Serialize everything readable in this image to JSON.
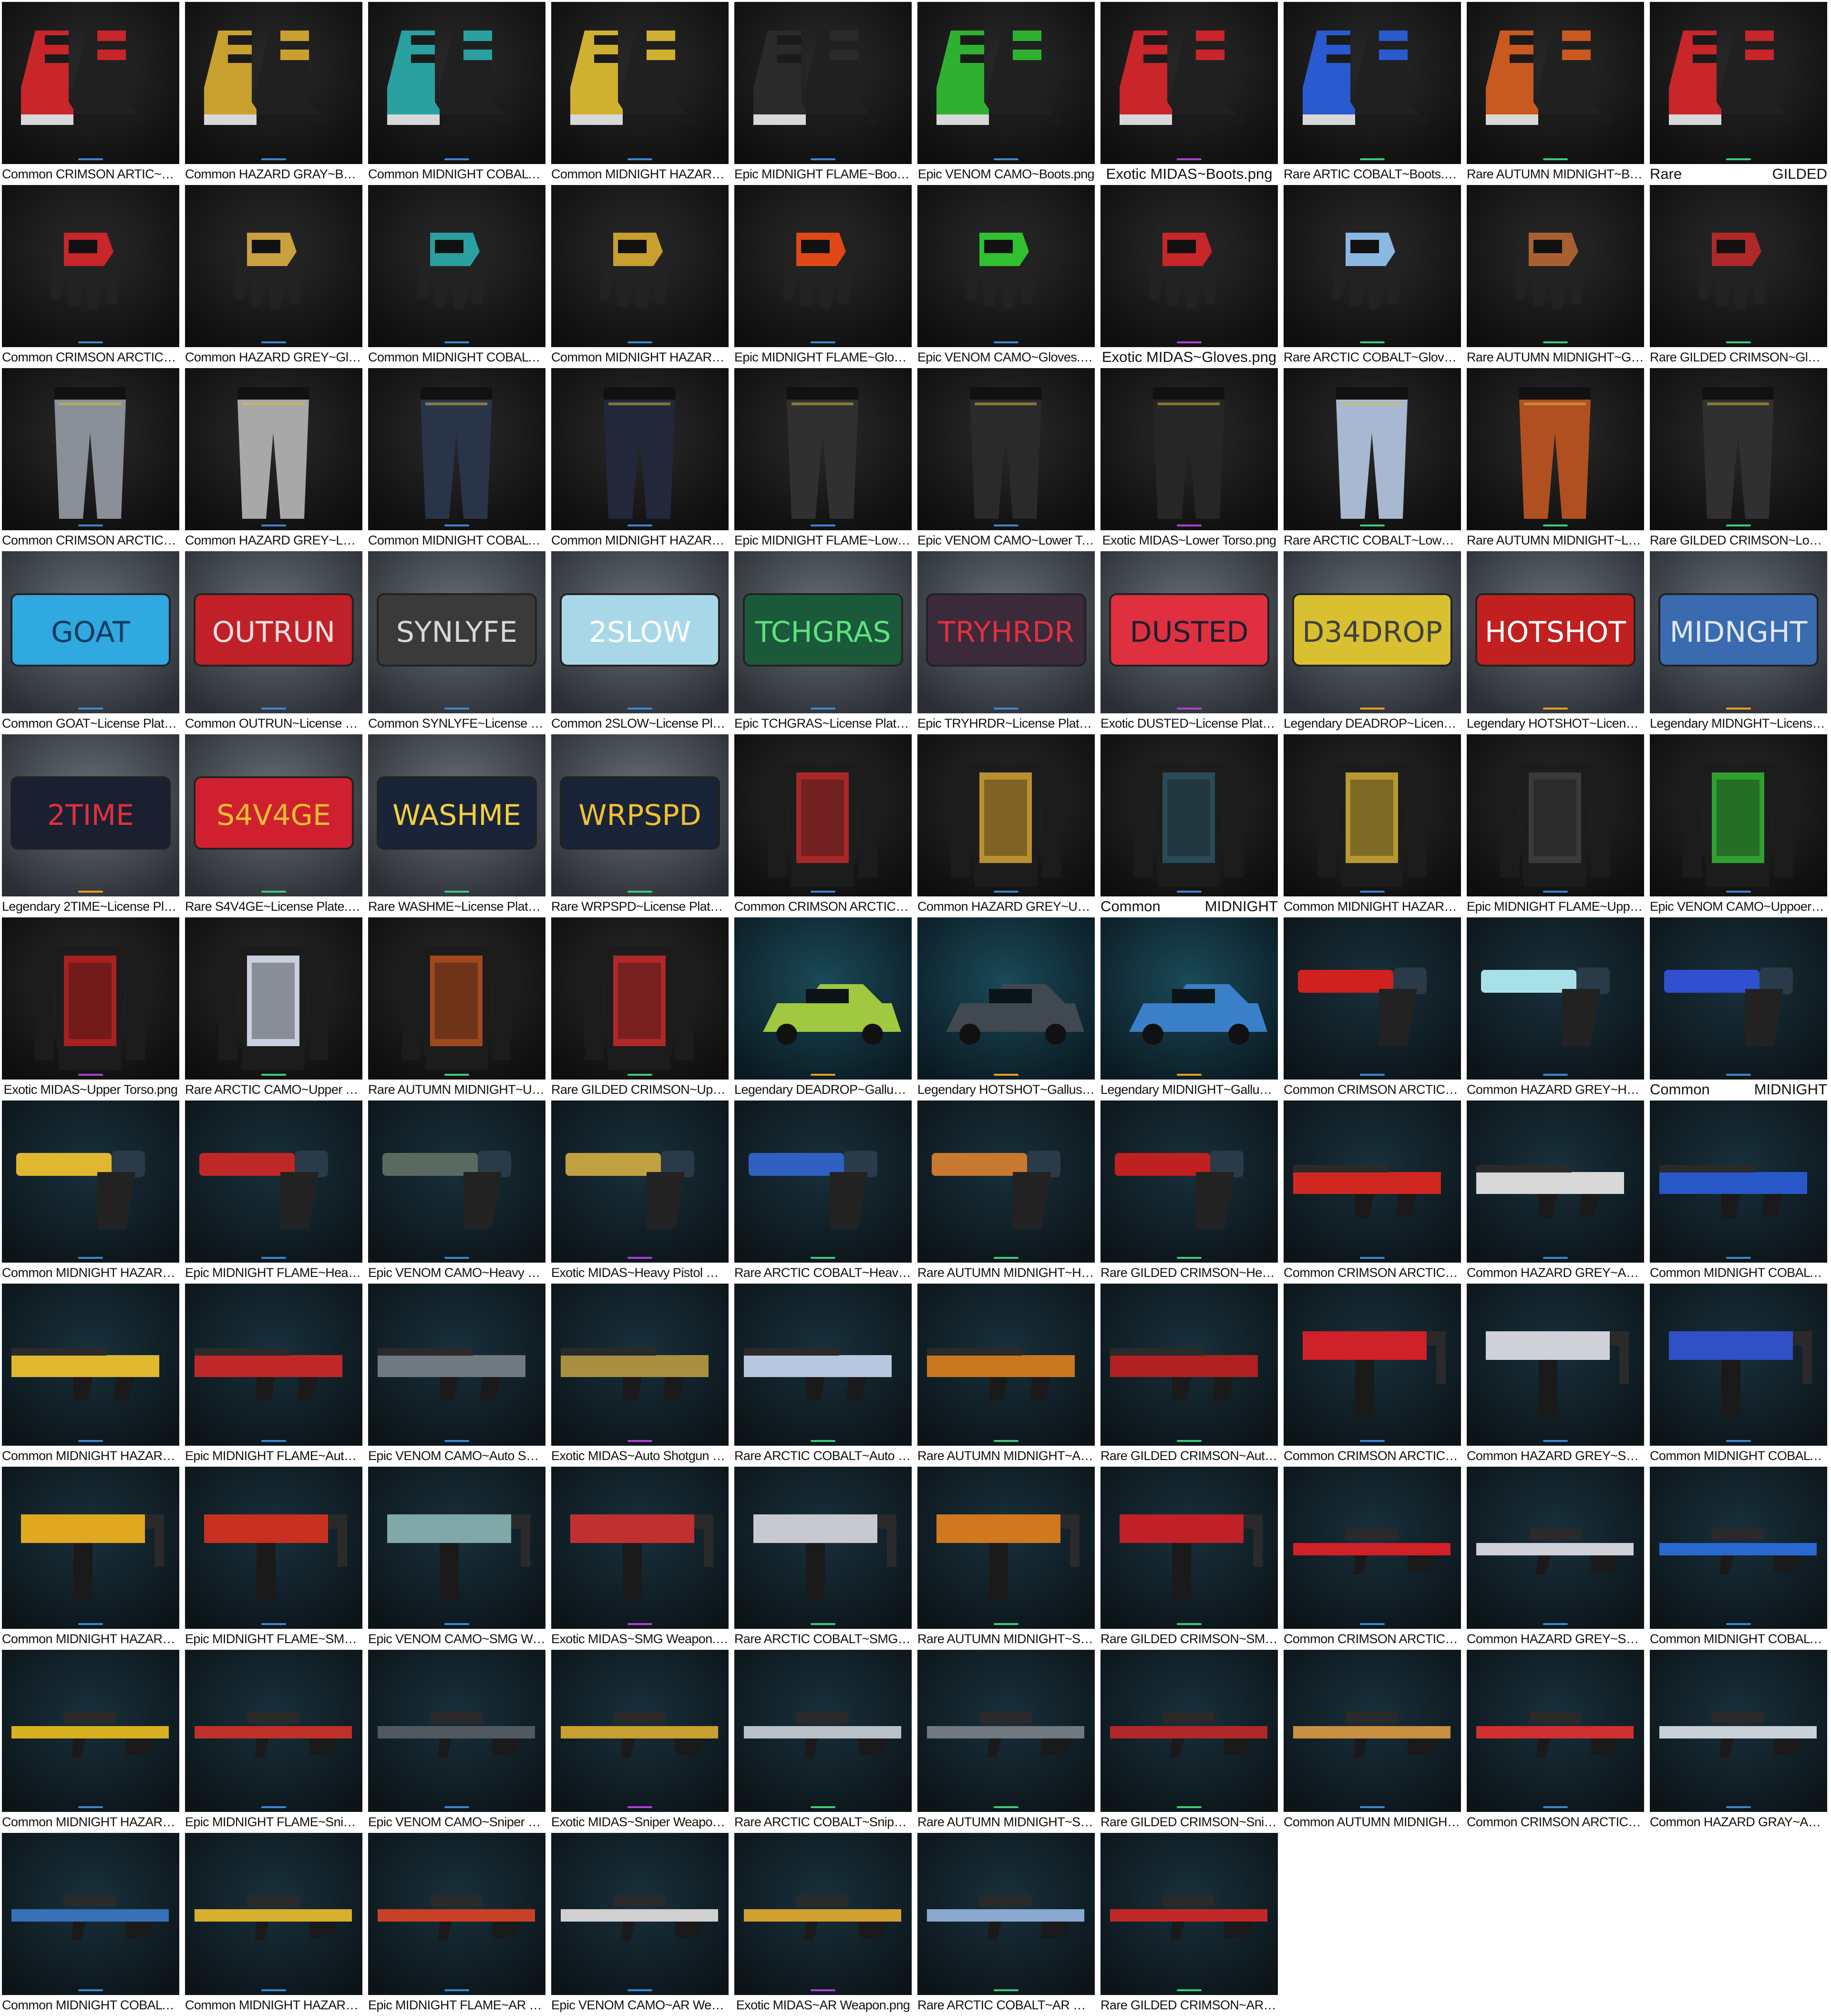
{
  "window": {
    "title": ""
  },
  "accent_colors": {
    "common": "#3a8ad8",
    "epic": "#3a8ad8",
    "exotic": "#b040d8",
    "rare": "#3ad07a",
    "legendary": "#f0a020"
  },
  "tiles": [
    {
      "label": "Common CRIMSON ARTIC~Boots.png",
      "category": "boots",
      "color": "#c8262a",
      "accent": "common"
    },
    {
      "label": "Common HAZARD GRAY~Boots.png",
      "category": "boots",
      "color": "#c8a030",
      "accent": "common"
    },
    {
      "label": "Common MIDNIGHT COBALT~Boots.png",
      "category": "boots",
      "color": "#2aa0a0",
      "accent": "common"
    },
    {
      "label": "Common MIDNIGHT HAZARD~Boots.png",
      "category": "boots",
      "color": "#d0b030",
      "accent": "common"
    },
    {
      "label": "Epic MIDNIGHT FLAME~Boots.png",
      "category": "boots",
      "color": "#2a2a2a",
      "accent": "epic"
    },
    {
      "label": "Epic VENOM CAMO~Boots.png",
      "category": "boots",
      "color": "#30b030",
      "accent": "epic"
    },
    {
      "label": "Exotic MIDAS~Boots.png",
      "category": "boots",
      "color": "#c8262a",
      "accent": "exotic"
    },
    {
      "label": "Rare ARTIC COBALT~Boots.png",
      "category": "boots",
      "color": "#2a5ad0",
      "accent": "rare"
    },
    {
      "label": "Rare AUTUMN MIDNIGHT~Boots.png",
      "category": "boots",
      "color": "#c85a20",
      "accent": "rare"
    },
    {
      "label": "Rare GILDED CRIMSON~Boots.png",
      "category": "boots",
      "color": "#c8262a",
      "accent": "rare",
      "split": [
        "Rare",
        "GILDED"
      ]
    },
    {
      "label": "Common CRIMSON ARCTIC~Gloves.png",
      "category": "gloves",
      "color": "#c8262a",
      "accent": "common"
    },
    {
      "label": "Common HAZARD GREY~Gloves.png",
      "category": "gloves",
      "color": "#c8a040",
      "accent": "common"
    },
    {
      "label": "Common MIDNIGHT COBALT~Gloves.png",
      "category": "gloves",
      "color": "#2aa0a0",
      "accent": "common"
    },
    {
      "label": "Common MIDNIGHT HAZARD~Gloves.png",
      "category": "gloves",
      "color": "#c8a030",
      "accent": "common"
    },
    {
      "label": "Epic MIDNIGHT FLAME~Gloves.png",
      "category": "gloves",
      "color": "#e04818",
      "accent": "epic"
    },
    {
      "label": "Epic VENOM CAMO~Gloves.png",
      "category": "gloves",
      "color": "#30c030",
      "accent": "epic"
    },
    {
      "label": "Exotic MIDAS~Gloves.png",
      "category": "gloves",
      "color": "#c8262a",
      "accent": "exotic"
    },
    {
      "label": "Rare ARCTIC COBALT~Gloves.png",
      "category": "gloves",
      "color": "#8ab8e0",
      "accent": "rare"
    },
    {
      "label": "Rare AUTUMN MIDNIGHT~Gloves.png",
      "category": "gloves",
      "color": "#a86030",
      "accent": "rare"
    },
    {
      "label": "Rare GILDED CRIMSON~Gloves.png",
      "category": "gloves",
      "color": "#b02828",
      "accent": "rare"
    },
    {
      "label": "Common CRIMSON ARCTIC~Lower Torso.png",
      "category": "pants",
      "color": "#8a9098",
      "accent": "common"
    },
    {
      "label": "Common HAZARD GREY~Lower Torso.png",
      "category": "pants",
      "color": "#a8a8a8",
      "accent": "common"
    },
    {
      "label": "Common MIDNIGHT COBALT~Lower Torso.png",
      "category": "pants",
      "color": "#2a3448",
      "accent": "common"
    },
    {
      "label": "Common MIDNIGHT HAZARD~Lower Torso.png",
      "category": "pants",
      "color": "#22283a",
      "accent": "common"
    },
    {
      "label": "Epic MIDNIGHT FLAME~Lower Torso.png",
      "category": "pants",
      "color": "#303030",
      "accent": "epic"
    },
    {
      "label": "Epic VENOM CAMO~Lower Torso.png",
      "category": "pants",
      "color": "#2a2a2a",
      "accent": "epic"
    },
    {
      "label": "Exotic MIDAS~Lower Torso.png",
      "category": "pants",
      "color": "#262626",
      "accent": "exotic"
    },
    {
      "label": "Rare ARCTIC COBALT~Lower Torso.png",
      "category": "pants",
      "color": "#a8b8d0",
      "accent": "rare"
    },
    {
      "label": "Rare AUTUMN MIDNIGHT~Lower Torso.png",
      "category": "pants",
      "color": "#b05020",
      "accent": "rare"
    },
    {
      "label": "Rare GILDED CRIMSON~Lower Torso.png",
      "category": "pants",
      "color": "#303030",
      "accent": "rare"
    },
    {
      "label": "Common GOAT~License Plate.png",
      "category": "plate",
      "color": "#30a8e0",
      "accent": "common",
      "plate_text": "GOAT",
      "text_color": "#0a3a60"
    },
    {
      "label": "Common OUTRUN~License Plate.png",
      "category": "plate",
      "color": "#c02028",
      "accent": "common",
      "plate_text": "OUTRUN",
      "text_color": "#f0e0e0"
    },
    {
      "label": "Common SYNLYFE~License Plate.png",
      "category": "plate",
      "color": "#3a3a3a",
      "accent": "common",
      "plate_text": "SYNLYFE",
      "text_color": "#d8d8d8"
    },
    {
      "label": "Common 2SLOW~License Plate.png",
      "category": "plate",
      "color": "#a8d8e8",
      "accent": "common",
      "plate_text": "2SLOW",
      "text_color": "#ffffff"
    },
    {
      "label": "Epic TCHGRAS~License Plate.png",
      "category": "plate",
      "color": "#1a5a3a",
      "accent": "epic",
      "plate_text": "TCHGRAS",
      "text_color": "#60e080"
    },
    {
      "label": "Epic TRYHRDR~License Plate.png",
      "category": "plate",
      "color": "#3a2a3a",
      "accent": "epic",
      "plate_text": "TRYHRDR",
      "text_color": "#e03040"
    },
    {
      "label": "Exotic DUSTED~License Plate.png",
      "category": "plate",
      "color": "#e03040",
      "accent": "exotic",
      "plate_text": "DUSTED",
      "text_color": "#1a2030"
    },
    {
      "label": "Legendary DEADROP~License Plate.png",
      "category": "plate",
      "color": "#d8c030",
      "accent": "legendary",
      "plate_text": "D34DROP",
      "text_color": "#404040"
    },
    {
      "label": "Legendary HOTSHOT~License Plate.png",
      "category": "plate",
      "color": "#c02020",
      "accent": "legendary",
      "plate_text": "HOTSHOT",
      "text_color": "#ffffff"
    },
    {
      "label": "Legendary MIDNGHT~License Plate.png",
      "category": "plate",
      "color": "#3a6ab0",
      "accent": "legendary",
      "plate_text": "MIDNGHT",
      "text_color": "#e0e8f0"
    },
    {
      "label": "Legendary 2TIME~License Plate.png",
      "category": "plate",
      "color": "#1a2030",
      "accent": "legendary",
      "plate_text": "2TIME",
      "text_color": "#e03040"
    },
    {
      "label": "Rare S4V4GE~License Plate.png",
      "category": "plate",
      "color": "#d02030",
      "accent": "rare",
      "plate_text": "S4V4GE",
      "text_color": "#f0c030"
    },
    {
      "label": "Rare WASHME~License Plate.png",
      "category": "plate",
      "color": "#1a2438",
      "accent": "rare",
      "plate_text": "WASHME",
      "text_color": "#f0d040"
    },
    {
      "label": "Rare WRPSPD~License Plate.png",
      "category": "plate",
      "color": "#1a2438",
      "accent": "rare",
      "plate_text": "WRPSPD",
      "text_color": "#f0c030"
    },
    {
      "label": "Common CRIMSON ARCTIC~Upper Torso.png",
      "category": "jacket",
      "color": "#a82828",
      "accent": "common"
    },
    {
      "label": "Common HAZARD GREY~Upper Torso.png",
      "category": "jacket",
      "color": "#b89030",
      "accent": "common"
    },
    {
      "label": "Common MIDNIGHT COBALT~Upper Torso.png",
      "category": "jacket",
      "color": "#2a4a58",
      "accent": "common",
      "split": [
        "Common",
        "MIDNIGHT"
      ]
    },
    {
      "label": "Common MIDNIGHT HAZARD~Upper Torso.png",
      "category": "jacket",
      "color": "#b89830",
      "accent": "common"
    },
    {
      "label": "Epic MIDNIGHT FLAME~Upper Torso.png",
      "category": "jacket",
      "color": "#3a3a3a",
      "accent": "epic"
    },
    {
      "label": "Epic VENOM CAMO~Uppoer Torso.png",
      "category": "jacket",
      "color": "#30a030",
      "accent": "epic"
    },
    {
      "label": "Exotic MIDAS~Upper Torso.png",
      "category": "jacket",
      "color": "#a82020",
      "accent": "exotic"
    },
    {
      "label": "Rare ARCTIC CAMO~Upper Torso.png",
      "category": "jacket",
      "color": "#c8d0e0",
      "accent": "rare"
    },
    {
      "label": "Rare AUTUMN MIDNIGHT~Upper Torso.png",
      "category": "jacket",
      "color": "#a04820",
      "accent": "rare"
    },
    {
      "label": "Rare GILDED CRIMSON~Upper Torso.png",
      "category": "jacket",
      "color": "#b02828",
      "accent": "rare"
    },
    {
      "label": "Legendary DEADROP~Gallus Vehicle.png",
      "category": "car",
      "color": "#a0c840",
      "accent": "legendary"
    },
    {
      "label": "Legendary HOTSHOT~Gallus Vehicle.png",
      "category": "car",
      "color": "#404850",
      "accent": "legendary"
    },
    {
      "label": "Legendary MIDNIGHT~Gallus Vehicle.png",
      "category": "car",
      "color": "#3a80c8",
      "accent": "legendary"
    },
    {
      "label": "Common CRIMSON ARCTIC~Heavy Pistol Weapon.png",
      "category": "pistol",
      "color": "#d02020",
      "accent": "common"
    },
    {
      "label": "Common HAZARD GREY~Heavy Pistol Weapon.png",
      "category": "pistol",
      "color": "#a8e0e8",
      "accent": "common"
    },
    {
      "label": "Common MIDNIGHT COBALT~Heavy Pistol Weapon.png",
      "category": "pistol",
      "color": "#3050d0",
      "accent": "common",
      "split": [
        "Common",
        "MIDNIGHT"
      ]
    },
    {
      "label": "Common MIDNIGHT HAZARD~Heavy Pistol Weapon.png",
      "category": "pistol",
      "color": "#e0b830",
      "accent": "common"
    },
    {
      "label": "Epic MIDNIGHT FLAME~Heavy Pistol Weapon.png",
      "category": "pistol",
      "color": "#c02828",
      "accent": "epic"
    },
    {
      "label": "Epic VENOM CAMO~Heavy Pistol Weapon.png",
      "category": "pistol",
      "color": "#5a6a60",
      "accent": "epic"
    },
    {
      "label": "Exotic MIDAS~Heavy Pistol Weapon.png",
      "category": "pistol",
      "color": "#c0a040",
      "accent": "exotic"
    },
    {
      "label": "Rare ARCTIC COBALT~Heavy Pistol Weapon.png",
      "category": "pistol",
      "color": "#3060c0",
      "accent": "rare"
    },
    {
      "label": "Rare AUTUMN MIDNIGHT~Heavy Pistol Weapon.png",
      "category": "pistol",
      "color": "#c87830",
      "accent": "rare"
    },
    {
      "label": "Rare GILDED CRIMSON~Heavy Pistol Weapon.png",
      "category": "pistol",
      "color": "#c02020",
      "accent": "rare"
    },
    {
      "label": "Common CRIMSON ARCTIC~Auto Shotgun Weapon.png",
      "category": "shotgun",
      "color": "#d02820",
      "accent": "common"
    },
    {
      "label": "Common HAZARD GREY~Auto Shotgun Weapon.png",
      "category": "shotgun",
      "color": "#d8d8d8",
      "accent": "common"
    },
    {
      "label": "Common MIDNIGHT COBALT~Auto Shotgun Weapon.png",
      "category": "shotgun",
      "color": "#2858c8",
      "accent": "common"
    },
    {
      "label": "Common MIDNIGHT HAZARD~Auto Shotgun Weapon.png",
      "category": "shotgun",
      "color": "#e0b830",
      "accent": "common"
    },
    {
      "label": "Epic MIDNIGHT FLAME~Auto Shotgun Weapon.png",
      "category": "shotgun",
      "color": "#c02828",
      "accent": "epic"
    },
    {
      "label": "Epic VENOM CAMO~Auto Shotgun Weapon.png",
      "category": "shotgun",
      "color": "#707880",
      "accent": "epic"
    },
    {
      "label": "Exotic MIDAS~Auto Shotgun Weapon.png",
      "category": "shotgun",
      "color": "#a89040",
      "accent": "exotic"
    },
    {
      "label": "Rare ARCTIC COBALT~Auto Shotgun Weapon.png",
      "category": "shotgun",
      "color": "#b8c8e0",
      "accent": "rare"
    },
    {
      "label": "Rare AUTUMN MIDNIGHT~Auto Shotgun Weapon.png",
      "category": "shotgun",
      "color": "#c87820",
      "accent": "rare"
    },
    {
      "label": "Rare GILDED CRIMSON~Auto Shotgun Weapon.png",
      "category": "shotgun",
      "color": "#b02020",
      "accent": "rare"
    },
    {
      "label": "Common CRIMSON ARCTIC~SMG Weapon.png",
      "category": "smg",
      "color": "#d02028",
      "accent": "common"
    },
    {
      "label": "Common HAZARD GREY~SMG Weapon.png",
      "category": "smg",
      "color": "#d0d0d8",
      "accent": "common"
    },
    {
      "label": "Common MIDNIGHT COBALT~SMG Weapon.png",
      "category": "smg",
      "color": "#3050c8",
      "accent": "common"
    },
    {
      "label": "Common MIDNIGHT HAZARD~SMG Weapon.png",
      "category": "smg",
      "color": "#e0a820",
      "accent": "common"
    },
    {
      "label": "Epic MIDNIGHT FLAME~SMG Weapon.png",
      "category": "smg",
      "color": "#c83020",
      "accent": "epic"
    },
    {
      "label": "Epic VENOM CAMO~SMG Weapon.png",
      "category": "smg",
      "color": "#80a8a8",
      "accent": "epic"
    },
    {
      "label": "Exotic MIDAS~SMG Weapon.png",
      "category": "smg",
      "color": "#c03030",
      "accent": "exotic"
    },
    {
      "label": "Rare ARCTIC COBALT~SMG Weapon.png",
      "category": "smg",
      "color": "#c8c8d0",
      "accent": "rare"
    },
    {
      "label": "Rare AUTUMN MIDNIGHT~SMG Weapon.png",
      "category": "smg",
      "color": "#d07820",
      "accent": "rare"
    },
    {
      "label": "Rare GILDED CRIMSON~SMG Weapon.png",
      "category": "smg",
      "color": "#c02028",
      "accent": "rare"
    },
    {
      "label": "Common CRIMSON ARCTIC~Sniper Weapon.png",
      "category": "sniper",
      "color": "#d02028",
      "accent": "common"
    },
    {
      "label": "Common HAZARD GREY~Sniper Weapon.png",
      "category": "sniper",
      "color": "#d0d0d8",
      "accent": "common"
    },
    {
      "label": "Common MIDNIGHT COBALT~Sniper Weapon.png",
      "category": "sniper",
      "color": "#2868d0",
      "accent": "common"
    },
    {
      "label": "Common MIDNIGHT HAZARD~Sniper Weapon.png",
      "category": "sniper",
      "color": "#d8b020",
      "accent": "common"
    },
    {
      "label": "Epic MIDNIGHT FLAME~Sniper Weapon.png",
      "category": "sniper",
      "color": "#c03028",
      "accent": "epic"
    },
    {
      "label": "Epic VENOM CAMO~Sniper Weapon.png",
      "category": "sniper",
      "color": "#505860",
      "accent": "epic"
    },
    {
      "label": "Exotic MIDAS~Sniper Weapon.png",
      "category": "sniper",
      "color": "#c8a030",
      "accent": "exotic"
    },
    {
      "label": "Rare ARCTIC COBALT~Sniper Weapon.png",
      "category": "sniper",
      "color": "#b8c0c8",
      "accent": "rare"
    },
    {
      "label": "Rare AUTUMN MIDNIGHT~Sniper Weapon.png",
      "category": "sniper",
      "color": "#707880",
      "accent": "rare"
    },
    {
      "label": "Rare GILDED CRIMSON~Sniper Weapon.png",
      "category": "sniper",
      "color": "#b02828",
      "accent": "rare"
    },
    {
      "label": "Common AUTUMN MIDNIGHT~AR Weapon.png",
      "category": "ar",
      "color": "#c89040",
      "accent": "common"
    },
    {
      "label": "Common CRIMSON ARCTIC~AR Weapon.png",
      "category": "ar",
      "color": "#d03030",
      "accent": "common"
    },
    {
      "label": "Common HAZARD GRAY~AR Weapon.png",
      "category": "ar",
      "color": "#c8d0d8",
      "accent": "common"
    },
    {
      "label": "Common MIDNIGHT COBALT~AR Weapon.png",
      "category": "ar",
      "color": "#3870b8",
      "accent": "common"
    },
    {
      "label": "Common MIDNIGHT HAZARD~AR Weapon.png",
      "category": "ar",
      "color": "#d8b030",
      "accent": "common"
    },
    {
      "label": "Epic MIDNIGHT FLAME~AR Weapon.png",
      "category": "ar",
      "color": "#c84028",
      "accent": "epic"
    },
    {
      "label": "Epic VENOM CAMO~AR Weapon.png",
      "category": "ar",
      "color": "#d0d0d0",
      "accent": "epic"
    },
    {
      "label": "Exotic MIDAS~AR Weapon.png",
      "category": "ar",
      "color": "#d0a030",
      "accent": "exotic"
    },
    {
      "label": "Rare ARCTIC COBALT~AR Weapon.png",
      "category": "ar",
      "color": "#8aa8d0",
      "accent": "rare"
    },
    {
      "label": "Rare GILDED CRIMSON~AR Weapon.png",
      "category": "ar",
      "color": "#c02828",
      "accent": "rare"
    }
  ]
}
